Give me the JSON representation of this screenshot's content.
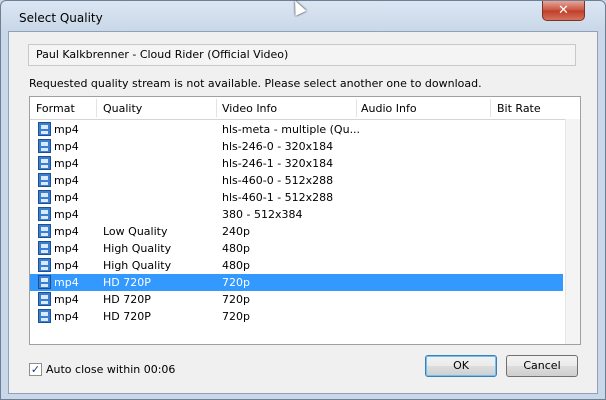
{
  "window": {
    "title": "Select Quality",
    "close_glyph": "✕"
  },
  "video_title": "Paul Kalkbrenner - Cloud Rider (Official Video)",
  "message": "Requested quality stream is not available. Please select another one to download.",
  "columns": [
    "Format",
    "Quality",
    "Video Info",
    "Audio Info",
    "Bit Rate"
  ],
  "rows": [
    {
      "format": "mp4",
      "quality": "",
      "video_info": "hls-meta - multiple (Qu...",
      "audio_info": "",
      "bit_rate": "",
      "selected": false
    },
    {
      "format": "mp4",
      "quality": "",
      "video_info": "hls-246-0 - 320x184",
      "audio_info": "",
      "bit_rate": "",
      "selected": false
    },
    {
      "format": "mp4",
      "quality": "",
      "video_info": "hls-246-1 - 320x184",
      "audio_info": "",
      "bit_rate": "",
      "selected": false
    },
    {
      "format": "mp4",
      "quality": "",
      "video_info": "hls-460-0 - 512x288",
      "audio_info": "",
      "bit_rate": "",
      "selected": false
    },
    {
      "format": "mp4",
      "quality": "",
      "video_info": "hls-460-1 - 512x288",
      "audio_info": "",
      "bit_rate": "",
      "selected": false
    },
    {
      "format": "mp4",
      "quality": "",
      "video_info": "380 - 512x384",
      "audio_info": "",
      "bit_rate": "",
      "selected": false
    },
    {
      "format": "mp4",
      "quality": "Low Quality",
      "video_info": "240p",
      "audio_info": "",
      "bit_rate": "",
      "selected": false
    },
    {
      "format": "mp4",
      "quality": "High Quality",
      "video_info": "480p",
      "audio_info": "",
      "bit_rate": "",
      "selected": false
    },
    {
      "format": "mp4",
      "quality": "High Quality",
      "video_info": "480p",
      "audio_info": "",
      "bit_rate": "",
      "selected": false
    },
    {
      "format": "mp4",
      "quality": "HD 720P",
      "video_info": "720p",
      "audio_info": "",
      "bit_rate": "",
      "selected": true
    },
    {
      "format": "mp4",
      "quality": "HD 720P",
      "video_info": "720p",
      "audio_info": "",
      "bit_rate": "",
      "selected": false
    },
    {
      "format": "mp4",
      "quality": "HD 720P",
      "video_info": "720p",
      "audio_info": "",
      "bit_rate": "",
      "selected": false
    }
  ],
  "auto_close": {
    "checked": true,
    "label": "Auto close within 00:06"
  },
  "buttons": {
    "ok": "OK",
    "cancel": "Cancel"
  },
  "icons": {
    "row_icon": "video-file-icon",
    "close": "close-icon",
    "check": "checkmark-icon",
    "cursor": "mouse-cursor-icon"
  },
  "colors": {
    "selection": "#3399ff",
    "title_bar": "#c9d7e8",
    "close_button": "#c8513d"
  }
}
